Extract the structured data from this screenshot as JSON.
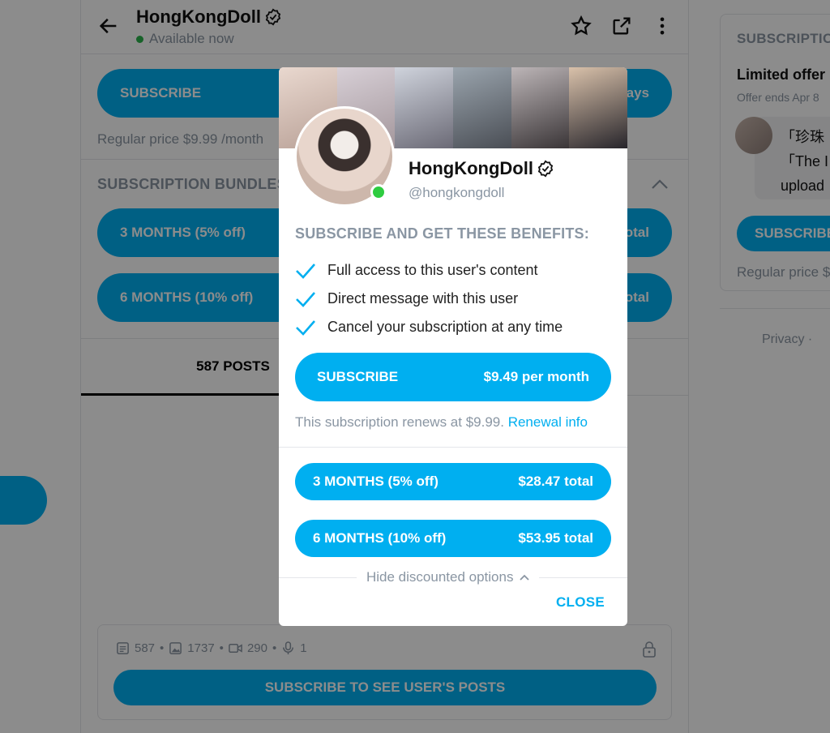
{
  "header": {
    "name": "HongKongDoll",
    "status": "Available now"
  },
  "bg": {
    "subscribe_label": "SUBSCRIBE",
    "subscribe_right": "ays",
    "regular_price": "Regular price $9.99 /month",
    "bundles_title": "SUBSCRIPTION BUNDLES",
    "bundle_3": "3 MONTHS (5% off)",
    "bundle_3_right": "otal",
    "bundle_6": "6 MONTHS (10% off)",
    "bundle_6_right": "otal",
    "tab_posts": "587 POSTS",
    "counts": {
      "posts": "587",
      "images": "1737",
      "videos": "290",
      "audio": "1"
    },
    "see_posts": "SUBSCRIBE TO SEE USER'S POSTS"
  },
  "right_card": {
    "title": "SUBSCRIPTIO",
    "offer": "Limited offer",
    "ends": "Offer ends Apr 8",
    "msg_line1": "「珍珠",
    "msg_line2": "「The I",
    "msg_line3": "upload",
    "subscribe": "SUBSCRIBE",
    "regular": "Regular price $",
    "privacy": "Privacy   ·"
  },
  "modal": {
    "name": "HongKongDoll",
    "handle": "@hongkongdoll",
    "benefits_title": "SUBSCRIBE AND GET THESE BENEFITS:",
    "benefits": [
      "Full access to this user's content",
      "Direct message with this user",
      "Cancel your subscription at any time"
    ],
    "subscribe_label": "SUBSCRIBE",
    "subscribe_price": "$9.49 per month",
    "renew_text": "This subscription renews at $9.99.",
    "renew_link": "Renewal info",
    "bundles": [
      {
        "label": "3 MONTHS (5% off)",
        "price": "$28.47 total"
      },
      {
        "label": "6 MONTHS (10% off)",
        "price": "$53.95 total"
      }
    ],
    "hide_options": "Hide discounted options",
    "close": "CLOSE"
  },
  "colors": {
    "accent": "#00aff0",
    "muted": "#8a96a3",
    "online": "#2ecc40"
  }
}
